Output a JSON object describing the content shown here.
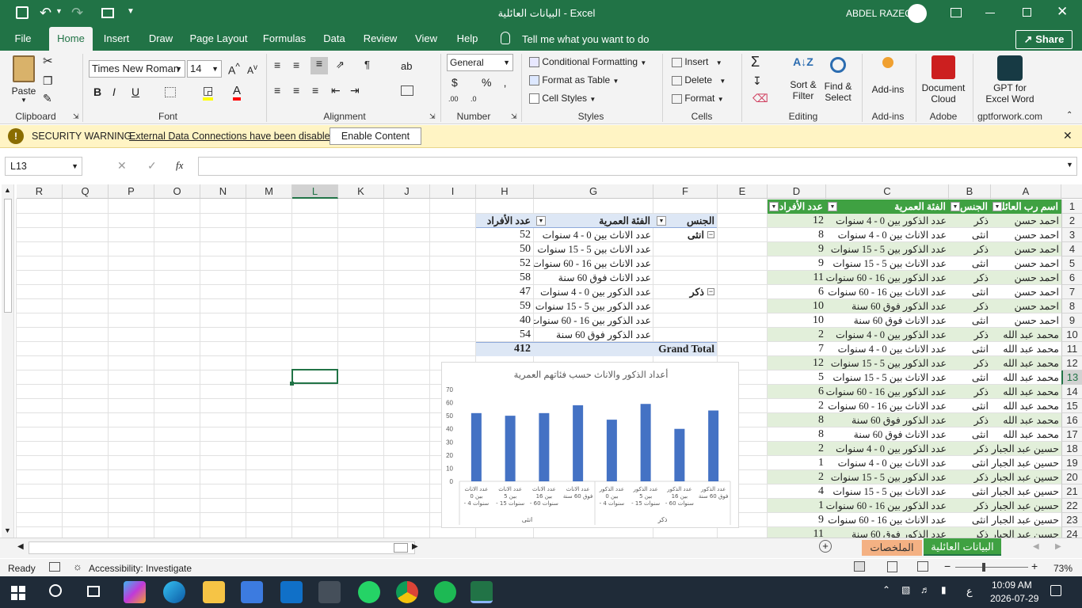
{
  "title": {
    "doc": "البيانات العائلية",
    "sep": "-",
    "app": "Excel",
    "user": "ABDEL RAZEQ"
  },
  "tabs": [
    "File",
    "Home",
    "Insert",
    "Draw",
    "Page Layout",
    "Formulas",
    "Data",
    "Review",
    "View",
    "Help"
  ],
  "tell_me": "Tell me what you want to do",
  "share": "Share",
  "ribbon": {
    "paste": "Paste",
    "clipboard": "Clipboard",
    "font_name": "Times New Roman",
    "font_size": "14",
    "font": "Font",
    "alignment": "Alignment",
    "number_format": "General",
    "number": "Number",
    "cond_format": "Conditional Formatting",
    "format_table": "Format as Table",
    "cell_styles": "Cell Styles",
    "styles": "Styles",
    "insert": "Insert",
    "delete": "Delete",
    "format": "Format",
    "cells": "Cells",
    "sort_filter_1": "Sort &",
    "sort_filter_2": "Filter",
    "find_select_1": "Find &",
    "find_select_2": "Select",
    "editing": "Editing",
    "addins": "Add-ins",
    "addins_group": "Add-ins",
    "doc_cloud_1": "Document",
    "doc_cloud_2": "Cloud",
    "adobe": "Adobe",
    "gpt_1": "GPT for",
    "gpt_2": "Excel Word",
    "gpt_group": "gptforwork.com"
  },
  "security": {
    "title": "SECURITY WARNING",
    "message": "External Data Connections have been disabled",
    "button": "Enable Content"
  },
  "name_box": "L13",
  "fx": "fx",
  "columns": [
    "R",
    "Q",
    "P",
    "O",
    "N",
    "M",
    "L",
    "K",
    "J",
    "I",
    "H",
    "G",
    "F",
    "E",
    "D",
    "C",
    "B",
    "A"
  ],
  "rows": [
    "1",
    "2",
    "3",
    "4",
    "5",
    "6",
    "7",
    "8",
    "9",
    "10",
    "11",
    "12",
    "13",
    "14",
    "15",
    "16",
    "17",
    "18",
    "19",
    "20",
    "21",
    "22",
    "23",
    "24"
  ],
  "table_headers": {
    "name": "اسم رب العائلة",
    "gender": "الجنس",
    "category": "الفئة العمرية",
    "count": "عدد الأفراد"
  },
  "table_rows": [
    {
      "name": "احمد حسن",
      "gender": "ذكر",
      "category": "عدد الذكور بين 0 - 4 سنوات",
      "count": "12"
    },
    {
      "name": "احمد حسن",
      "gender": "انثى",
      "category": "عدد الاناث بين 0 - 4 سنوات",
      "count": "8"
    },
    {
      "name": "احمد حسن",
      "gender": "ذكر",
      "category": "عدد الذكور بين 5 - 15 سنوات",
      "count": "9"
    },
    {
      "name": "احمد حسن",
      "gender": "انثى",
      "category": "عدد الاناث بين 5 - 15 سنوات",
      "count": "9"
    },
    {
      "name": "احمد حسن",
      "gender": "ذكر",
      "category": "عدد الذكور بين 16 - 60 سنوات",
      "count": "11"
    },
    {
      "name": "احمد حسن",
      "gender": "انثى",
      "category": "عدد الاناث بين 16 - 60 سنوات",
      "count": "6"
    },
    {
      "name": "احمد حسن",
      "gender": "ذكر",
      "category": "عدد الذكور فوق 60 سنة",
      "count": "10"
    },
    {
      "name": "احمد حسن",
      "gender": "انثى",
      "category": "عدد الاناث فوق 60 سنة",
      "count": "10"
    },
    {
      "name": "محمد عبد الله",
      "gender": "ذكر",
      "category": "عدد الذكور بين 0 - 4 سنوات",
      "count": "2"
    },
    {
      "name": "محمد عبد الله",
      "gender": "انثى",
      "category": "عدد الاناث بين 0 - 4 سنوات",
      "count": "7"
    },
    {
      "name": "محمد عبد الله",
      "gender": "ذكر",
      "category": "عدد الذكور بين 5 - 15 سنوات",
      "count": "12"
    },
    {
      "name": "محمد عبد الله",
      "gender": "انثى",
      "category": "عدد الاناث بين 5 - 15 سنوات",
      "count": "5"
    },
    {
      "name": "محمد عبد الله",
      "gender": "ذكر",
      "category": "عدد الذكور بين 16 - 60 سنوات",
      "count": "6"
    },
    {
      "name": "محمد عبد الله",
      "gender": "انثى",
      "category": "عدد الاناث بين 16 - 60 سنوات",
      "count": "2"
    },
    {
      "name": "محمد عبد الله",
      "gender": "ذكر",
      "category": "عدد الذكور فوق 60 سنة",
      "count": "8"
    },
    {
      "name": "محمد عبد الله",
      "gender": "انثى",
      "category": "عدد الاناث فوق 60 سنة",
      "count": "8"
    },
    {
      "name": "حسين عبد الجبار",
      "gender": "ذكر",
      "category": "عدد الذكور بين 0 - 4 سنوات",
      "count": "2"
    },
    {
      "name": "حسين عبد الجبار",
      "gender": "انثى",
      "category": "عدد الاناث بين 0 - 4 سنوات",
      "count": "1"
    },
    {
      "name": "حسين عبد الجبار",
      "gender": "ذكر",
      "category": "عدد الذكور بين 5 - 15 سنوات",
      "count": "2"
    },
    {
      "name": "حسين عبد الجبار",
      "gender": "انثى",
      "category": "عدد الاناث بين 5 - 15 سنوات",
      "count": "4"
    },
    {
      "name": "حسين عبد الجبار",
      "gender": "ذكر",
      "category": "عدد الذكور بين 16 - 60 سنوات",
      "count": "1"
    },
    {
      "name": "حسين عبد الجبار",
      "gender": "انثى",
      "category": "عدد الاناث بين 16 - 60 سنوات",
      "count": "9"
    },
    {
      "name": "حسين عبد الجبار",
      "gender": "ذكر",
      "category": "عدد الذكور فوق 60 سنة",
      "count": "11"
    }
  ],
  "pivot": {
    "h_gender": "الجنس",
    "h_category": "الفئة العمرية",
    "h_count": "عدد الأفراد",
    "female_label": "انثى",
    "male_label": "ذكر",
    "female_rows": [
      {
        "category": "عدد الاناث بين 0 - 4 سنوات",
        "count": "52"
      },
      {
        "category": "عدد الاناث بين 5 - 15 سنوات",
        "count": "50"
      },
      {
        "category": "عدد الاناث بين 16 - 60 سنوات",
        "count": "52"
      },
      {
        "category": "عدد الاناث فوق 60 سنة",
        "count": "58"
      }
    ],
    "male_rows": [
      {
        "category": "عدد الذكور بين 0 - 4 سنوات",
        "count": "47"
      },
      {
        "category": "عدد الذكور بين 5 - 15 سنوات",
        "count": "59"
      },
      {
        "category": "عدد الذكور بين 16 - 60 سنوات",
        "count": "40"
      },
      {
        "category": "عدد الذكور فوق 60 سنة",
        "count": "54"
      }
    ],
    "grand_total_label": "Grand Total",
    "grand_total": "412"
  },
  "chart_data": {
    "type": "bar",
    "title": "أعداد الذكور والاناث حسب فئاتهم العمرية",
    "categories": [
      [
        "عدد الاناث",
        "بين 0",
        "- 4 سنوات"
      ],
      [
        "عدد الاناث",
        "بين 5",
        "- 15 سنوات"
      ],
      [
        "عدد الاناث",
        "بين 16",
        "- 60 سنوات"
      ],
      [
        "عدد الاناث",
        "فوق 60 سنة"
      ],
      [
        "عدد الذكور",
        "بين 0",
        "- 4 سنوات"
      ],
      [
        "عدد الذكور",
        "بين 5",
        "- 15 سنوات"
      ],
      [
        "عدد الذكور",
        "بين 16",
        "- 60 سنوات"
      ],
      [
        "عدد الذكور",
        "فوق 60 سنة"
      ]
    ],
    "groups": [
      "انثى",
      "ذكر"
    ],
    "values": [
      52,
      50,
      52,
      58,
      47,
      59,
      40,
      54
    ],
    "ylim": [
      0,
      70
    ],
    "yticks": [
      "0",
      "10",
      "20",
      "30",
      "40",
      "50",
      "60",
      "70"
    ],
    "bar_color": "#4472c4"
  },
  "sheet_tabs": {
    "active": "البيانات العائلية",
    "other": "الملخصات"
  },
  "status": {
    "ready": "Ready",
    "accessibility": "Accessibility: Investigate",
    "zoom": "73%"
  },
  "taskbar": {
    "time": "10:09 AM",
    "date": "2026-07-29",
    "lang": "ع"
  },
  "colors": {
    "excel_green": "#217346",
    "header_green": "#3fa142",
    "band_green": "#e2efda"
  }
}
